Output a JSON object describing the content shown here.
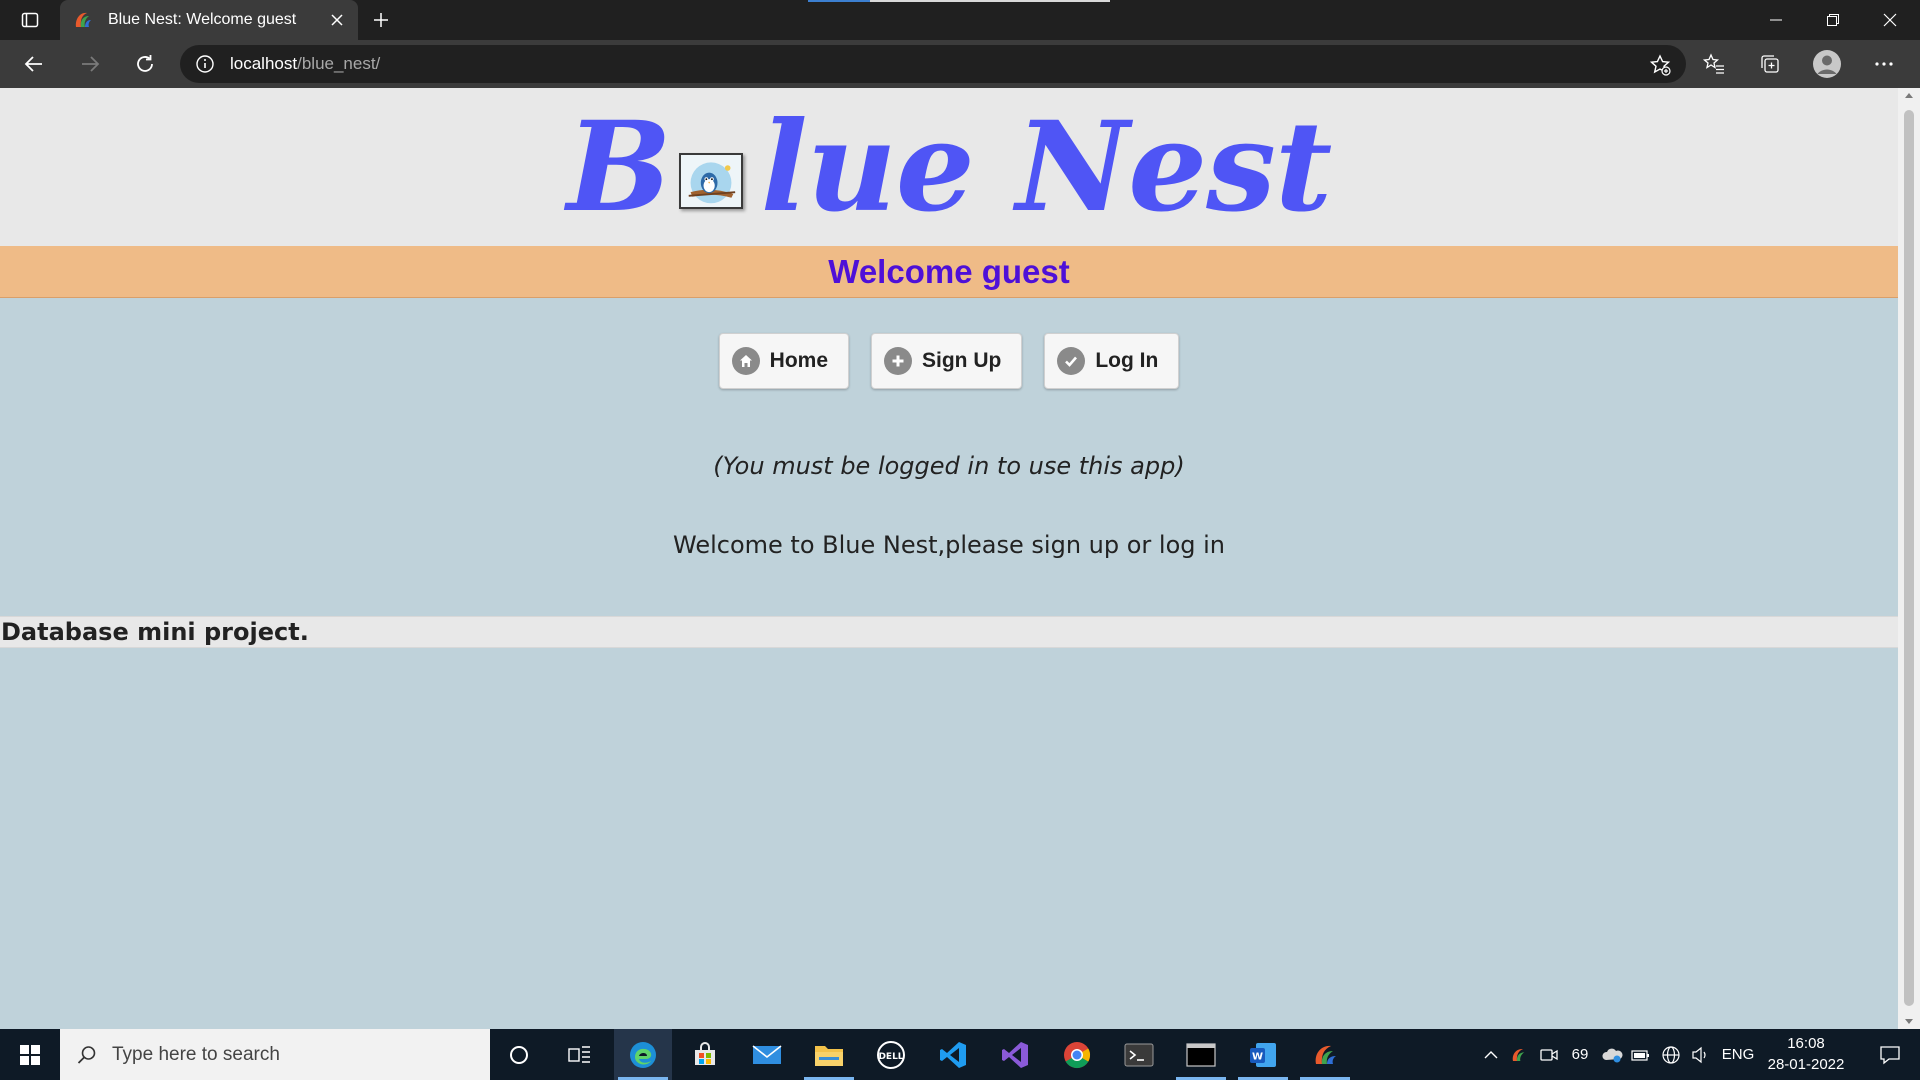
{
  "browser": {
    "tab_title": "Blue Nest: Welcome guest",
    "url_host": "localhost",
    "url_path": "/blue_nest/"
  },
  "page": {
    "logo_first_letter": "B",
    "logo_rest": "lue Nest",
    "welcome": "Welcome guest",
    "buttons": [
      {
        "label": "Home",
        "icon": "home-icon"
      },
      {
        "label": "Sign Up",
        "icon": "plus-icon"
      },
      {
        "label": "Log In",
        "icon": "check-icon"
      }
    ],
    "note": "(You must be logged in to use this app)",
    "intro": "Welcome to Blue Nest,please sign up or log in",
    "footer": "Database mini project."
  },
  "taskbar": {
    "search_placeholder": "Type here to search",
    "temperature": "69",
    "language": "ENG",
    "time": "16:08",
    "date": "28-01-2022"
  },
  "colors": {
    "logo": "#4f55f5",
    "welcome_bar": "#efbb87",
    "welcome_text": "#4e10d8",
    "page_bg": "#bfd2da",
    "header_bg": "#e8e8e8"
  }
}
